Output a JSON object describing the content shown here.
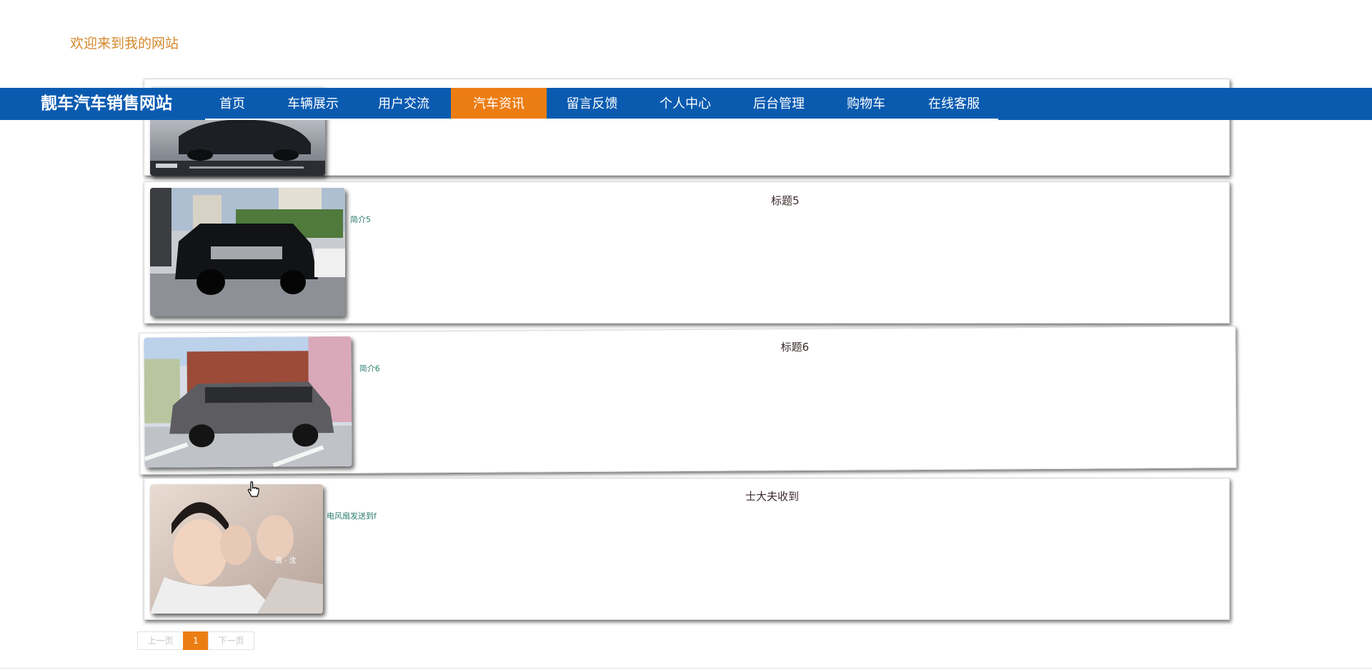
{
  "header": {
    "welcome": "欢迎来到我的网站"
  },
  "nav": {
    "brand": "靓车汽车销售网站",
    "items": [
      {
        "label": "首页"
      },
      {
        "label": "车辆展示"
      },
      {
        "label": "用户交流"
      },
      {
        "label": "汽车资讯",
        "active": true
      },
      {
        "label": "留言反馈"
      },
      {
        "label": "个人中心"
      },
      {
        "label": "后台管理"
      },
      {
        "label": "购物车"
      },
      {
        "label": "在线客服"
      }
    ]
  },
  "articles": [
    {
      "title": "",
      "summary": "",
      "image": "car-photo"
    },
    {
      "title": "标题5",
      "summary": "简介5",
      "image": "black-suv-photo"
    },
    {
      "title": "标题6",
      "summary": "简介6",
      "image": "gray-minivan-photo"
    },
    {
      "title": "士大夫收到",
      "summary": "电风扇发送到f",
      "image": "costume-drama-photo"
    }
  ],
  "pagination": {
    "prev": "上一页",
    "current": "1",
    "next": "下一页"
  },
  "colors": {
    "nav_bg": "#0a5bb0",
    "accent": "#ec7d13",
    "welcome": "#d4892c"
  }
}
